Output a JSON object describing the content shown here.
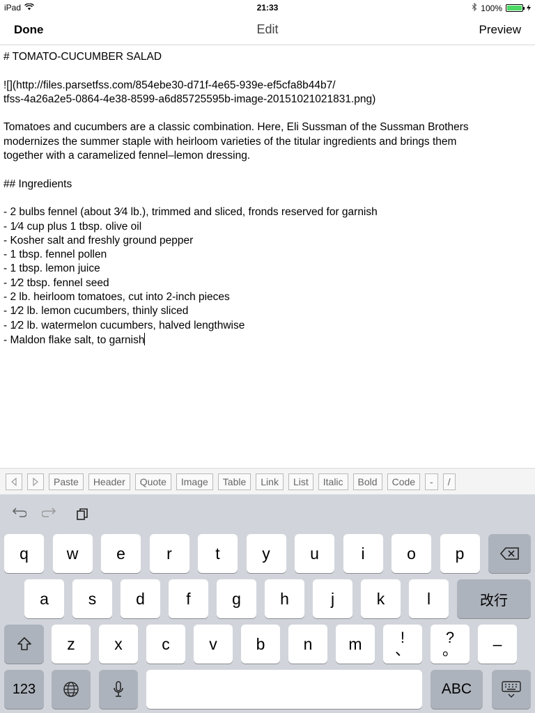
{
  "status": {
    "carrier": "iPad",
    "time": "21:33",
    "battery": "100%",
    "battery_level": 1.0,
    "icons": [
      "wifi-icon",
      "bluetooth-icon",
      "battery-icon"
    ]
  },
  "nav": {
    "done": "Done",
    "title": "Edit",
    "preview": "Preview"
  },
  "editor": {
    "lines": [
      "# TOMATO-CUCUMBER SALAD",
      "",
      "![](http://files.parsetfss.com/854ebe30-d71f-4e65-939e-ef5cfa8b44b7/",
      "tfss-4a26a2e5-0864-4e38-8599-a6d85725595b-image-20151021021831.png)",
      "",
      "Tomatoes and cucumbers are a classic combination. Here, Eli Sussman of the Sussman Brothers",
      "modernizes the summer staple with heirloom varieties of the titular ingredients and brings them",
      "together with a caramelized fennel–lemon dressing.",
      "",
      "## Ingredients",
      "",
      "- 2 bulbs fennel (about 3⁄4 lb.), trimmed and sliced, fronds reserved for garnish",
      "- 1⁄4 cup plus 1 tbsp. olive oil",
      "- Kosher salt and freshly ground pepper",
      "- 1 tbsp. fennel pollen",
      "- 1 tbsp. lemon juice",
      "- 1⁄2 tbsp. fennel seed",
      "- 2 lb. heirloom tomatoes, cut into 2-inch pieces",
      "- 1⁄2 lb. lemon cucumbers, thinly sliced",
      "- 1⁄2 lb. watermelon cucumbers, halved lengthwise",
      "- Maldon flake salt, to garnish"
    ]
  },
  "toolbar": {
    "prev_icon": "arrow-left-icon",
    "next_icon": "arrow-right-icon",
    "buttons": [
      "Paste",
      "Header",
      "Quote",
      "Image",
      "Table",
      "Link",
      "List",
      "Italic",
      "Bold",
      "Code",
      "-",
      "/"
    ]
  },
  "keyboard": {
    "row1": [
      "q",
      "w",
      "e",
      "r",
      "t",
      "y",
      "u",
      "i",
      "o",
      "p"
    ],
    "row2": [
      "a",
      "s",
      "d",
      "f",
      "g",
      "h",
      "j",
      "k",
      "l"
    ],
    "return_label": "改行",
    "row3": [
      "z",
      "x",
      "c",
      "v",
      "b",
      "n",
      "m"
    ],
    "row3_punct": [
      [
        "!",
        "、"
      ],
      [
        "?",
        "。"
      ]
    ],
    "dash": "–",
    "numbers_label": "123",
    "abc_label": "ABC",
    "icons": [
      "undo-icon",
      "redo-icon",
      "paste-icon",
      "delete-icon",
      "shift-icon",
      "globe-icon",
      "microphone-icon",
      "hide-keyboard-icon"
    ]
  },
  "colors": {
    "battery_fill": "#4cd964",
    "keyboard_bg": "#d1d5db",
    "key_gray": "#adb3bc"
  }
}
